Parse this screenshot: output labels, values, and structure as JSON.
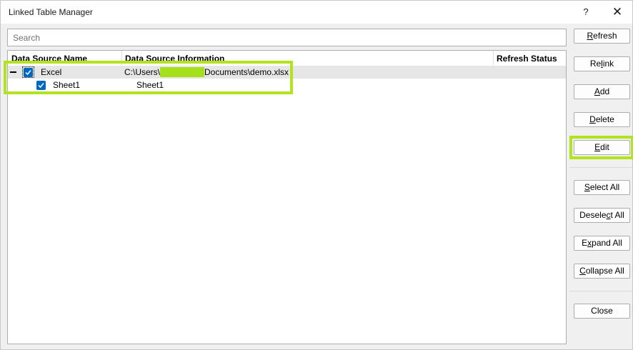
{
  "window": {
    "title": "Linked Table Manager",
    "help": "?",
    "close": "✕"
  },
  "search": {
    "placeholder": "Search",
    "value": ""
  },
  "table": {
    "columns": [
      "Data Source Name",
      "Data Source Information",
      "Refresh Status"
    ],
    "rows": [
      {
        "name": "Excel",
        "info_prefix": "C:\\Users\\",
        "info_suffix": "Documents\\demo.xlsx",
        "status": "",
        "checked": true,
        "expanded": true
      },
      {
        "name": "Sheet1",
        "info": "Sheet1",
        "status": "",
        "checked": true
      }
    ]
  },
  "buttons": {
    "refresh": {
      "pre": "",
      "key": "R",
      "post": "efresh"
    },
    "relink": {
      "pre": "Re",
      "key": "l",
      "post": "ink"
    },
    "add": {
      "pre": "",
      "key": "A",
      "post": "dd"
    },
    "delete": {
      "pre": "",
      "key": "D",
      "post": "elete"
    },
    "edit": {
      "pre": "",
      "key": "E",
      "post": "dit"
    },
    "select_all": {
      "pre": "",
      "key": "S",
      "post": "elect All"
    },
    "deselect_all": {
      "pre": "Desele",
      "key": "c",
      "post": "t All"
    },
    "expand_all": {
      "pre": "E",
      "key": "x",
      "post": "pand All"
    },
    "collapse_all": {
      "pre": "",
      "key": "C",
      "post": "ollapse All"
    },
    "close": {
      "label": "Close"
    }
  },
  "colors": {
    "highlight": "#b2e31e",
    "checkbox": "#0067c0",
    "redaction": "#a6e01b"
  }
}
